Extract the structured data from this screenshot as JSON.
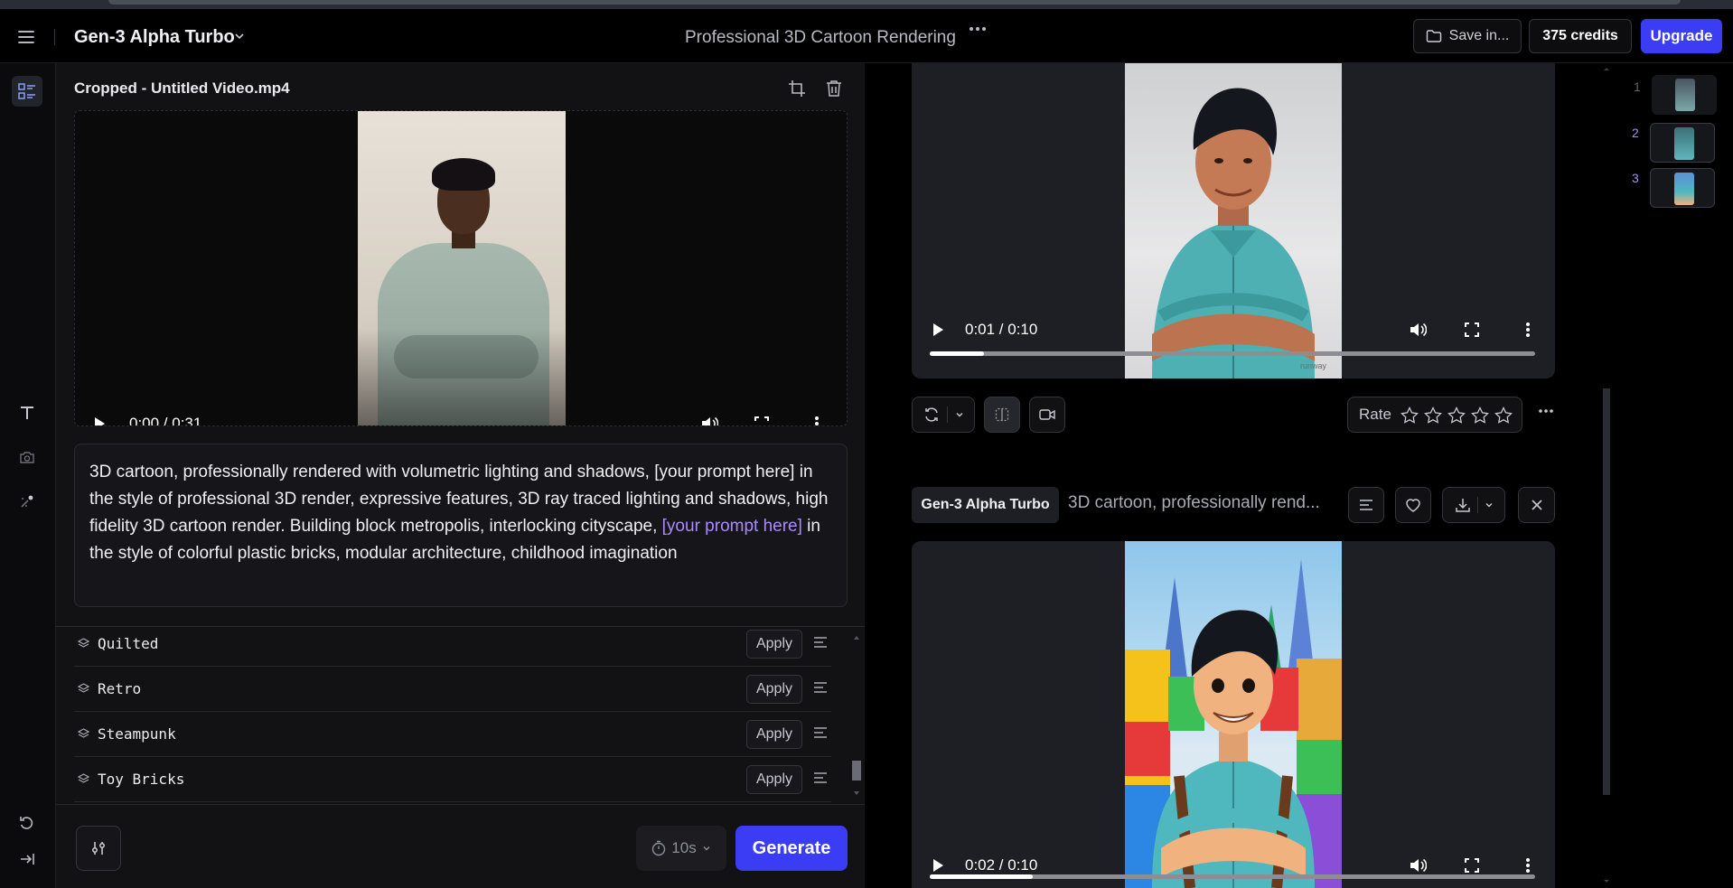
{
  "header": {
    "model_name": "Gen-3 Alpha Turbo",
    "project_title": "Professional 3D Cartoon Rendering",
    "save_label": "Save in...",
    "credits_label": "375 credits",
    "upgrade_label": "Upgrade"
  },
  "input": {
    "file_name": "Cropped - Untitled Video.mp4",
    "video_time": "0:00 / 0:31",
    "prompt_parts": [
      "3D cartoon, professionally rendered with volumetric lighting and shadows, [your prompt here] in the style of professional 3D render, expressive features, 3D ray traced lighting and shadows, high fidelity 3D cartoon render. Building block metropolis, interlocking cityscape, ",
      "[your prompt here]",
      " in the style of colorful plastic bricks, modular architecture, childhood imagination"
    ]
  },
  "styles": [
    {
      "name": "Quilted",
      "apply": "Apply"
    },
    {
      "name": "Retro",
      "apply": "Apply"
    },
    {
      "name": "Steampunk",
      "apply": "Apply"
    },
    {
      "name": "Toy Bricks",
      "apply": "Apply"
    }
  ],
  "footer": {
    "duration": "10s",
    "generate_label": "Generate"
  },
  "output1": {
    "video_time": "0:01 / 0:10",
    "progress": 0.09,
    "watermark": "runway",
    "rate_label": "Rate"
  },
  "output2": {
    "model_chip": "Gen-3 Alpha Turbo",
    "prompt_preview": "3D cartoon, professionally rend...",
    "video_time": "0:02 / 0:10",
    "progress": 0.17
  },
  "thumbnails": [
    {
      "num": "1"
    },
    {
      "num": "2"
    },
    {
      "num": "3"
    }
  ],
  "colors": {
    "accent": "#3b3df5",
    "highlight": "#a98bff"
  }
}
